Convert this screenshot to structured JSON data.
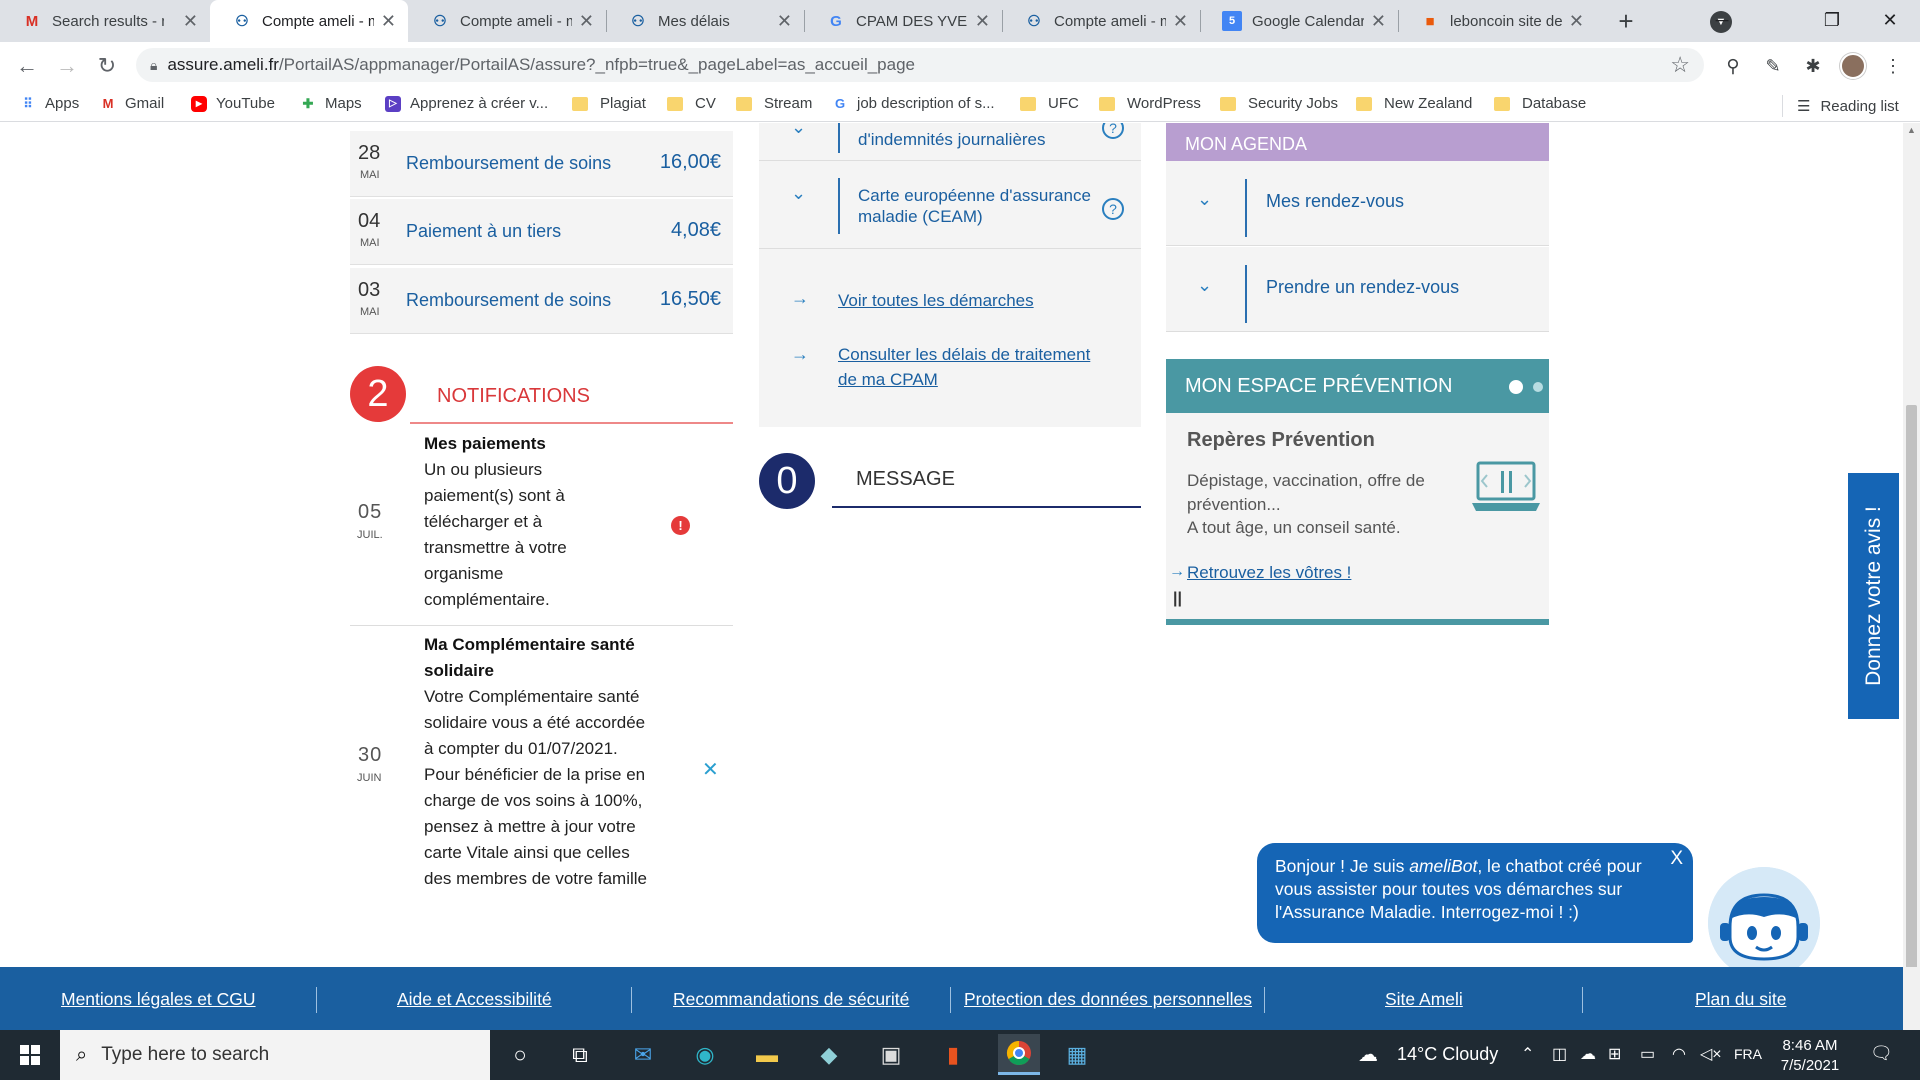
{
  "tabs": [
    {
      "label": "Search results - n",
      "icon": "gmail-icon",
      "active": false
    },
    {
      "label": "Compte ameli - m",
      "icon": "ameli-icon",
      "active": true
    },
    {
      "label": "Compte ameli - m",
      "icon": "ameli-icon",
      "active": false
    },
    {
      "label": "Mes délais",
      "icon": "ameli-icon",
      "active": false
    },
    {
      "label": "CPAM DES YVELIN",
      "icon": "google-icon",
      "active": false
    },
    {
      "label": "Compte ameli - m",
      "icon": "ameli-icon",
      "active": false
    },
    {
      "label": "Google Calendar",
      "icon": "calendar-icon",
      "active": false
    },
    {
      "label": "leboncoin site de",
      "icon": "leboncoin-icon",
      "active": false
    }
  ],
  "address": {
    "host": "assure.ameli.fr",
    "path": "/PortailAS/appmanager/PortailAS/assure?_nfpb=true&_pageLabel=as_accueil_page"
  },
  "bookmarks": [
    {
      "label": "Apps",
      "type": "apps"
    },
    {
      "label": "Gmail",
      "type": "gmail"
    },
    {
      "label": "YouTube",
      "type": "youtube"
    },
    {
      "label": "Maps",
      "type": "maps"
    },
    {
      "label": "Apprenez à créer v...",
      "type": "site"
    },
    {
      "label": "Plagiat",
      "type": "folder"
    },
    {
      "label": "CV",
      "type": "folder"
    },
    {
      "label": "Stream",
      "type": "folder"
    },
    {
      "label": "job description of s...",
      "type": "google"
    },
    {
      "label": "UFC",
      "type": "folder"
    },
    {
      "label": "WordPress",
      "type": "folder"
    },
    {
      "label": "Security Jobs",
      "type": "folder"
    },
    {
      "label": "New Zealand",
      "type": "folder"
    },
    {
      "label": "Database",
      "type": "folder"
    }
  ],
  "reading_list": "Reading list",
  "payments": [
    {
      "day": "28",
      "month": "MAI",
      "label": "Remboursement de soins",
      "amount": "16,00€"
    },
    {
      "day": "04",
      "month": "MAI",
      "label": "Paiement à un tiers",
      "amount": "4,08€"
    },
    {
      "day": "03",
      "month": "MAI",
      "label": "Remboursement de soins",
      "amount": "16,50€"
    }
  ],
  "notifications": {
    "count": "2",
    "title": "NOTIFICATIONS",
    "items": [
      {
        "day": "05",
        "month": "JUIL.",
        "title": "Mes paiements",
        "body": [
          "Un ou plusieurs",
          "paiement(s) sont à",
          "télécharger et à",
          "transmettre à votre",
          "organisme",
          "complémentaire."
        ]
      },
      {
        "day": "30",
        "month": "JUIN",
        "title": [
          "Ma Complémentaire santé",
          "solidaire"
        ],
        "body": [
          "Votre Complémentaire santé",
          "solidaire vous a été accordée",
          "à compter du 01/07/2021.",
          "Pour bénéficier de la prise en",
          "charge de vos soins à 100%,",
          "pensez à mettre à jour votre",
          "carte Vitale ainsi que celles",
          "des membres de votre famille"
        ]
      }
    ]
  },
  "demarches": {
    "rows": [
      {
        "lines": [
          "d'indemnités journalières"
        ]
      },
      {
        "lines": [
          "Carte européenne d'assurance",
          "maladie (CEAM)"
        ]
      }
    ],
    "links": [
      {
        "lines": [
          "Voir toutes les démarches"
        ]
      },
      {
        "lines": [
          "Consulter les délais de traitement",
          "de ma CPAM"
        ]
      }
    ]
  },
  "messages": {
    "count": "0",
    "title": "MESSAGE"
  },
  "agenda": {
    "title": "MON AGENDA",
    "items": [
      "Mes rendez-vous",
      "Prendre un rendez-vous"
    ]
  },
  "prevention": {
    "title": "MON ESPACE PRÉVENTION",
    "subtitle": "Repères Prévention",
    "text1": "Dépistage, vaccination, offre de prévention...",
    "text2": "A tout âge, un conseil santé.",
    "link": "Retrouvez les vôtres !"
  },
  "feedback": "Donnez votre avis !",
  "chatbot": {
    "pre": "Bonjour ! Je suis ",
    "name": "ameliBot",
    "post": ", le chatbot créé pour vous assister pour toutes vos démarches sur l'Assurance Maladie. Interrogez-moi ! :)",
    "close": "X"
  },
  "footer": [
    "Mentions légales et CGU",
    "Aide et Accessibilité",
    "Recommandations de sécurité",
    "Protection des données personnelles",
    "Site Ameli",
    "Plan du site"
  ],
  "taskbar": {
    "search_placeholder": "Type here to search",
    "weather": "14°C  Cloudy",
    "lang": "FRA",
    "time": "8:46 AM",
    "date": "7/5/2021"
  },
  "colors": {
    "ameli_blue": "#1a5fa0",
    "notif_red": "#e53a3a",
    "agenda_purple": "#b89ed0",
    "prevention_teal": "#4a98a3",
    "message_navy": "#1c2b6b"
  }
}
